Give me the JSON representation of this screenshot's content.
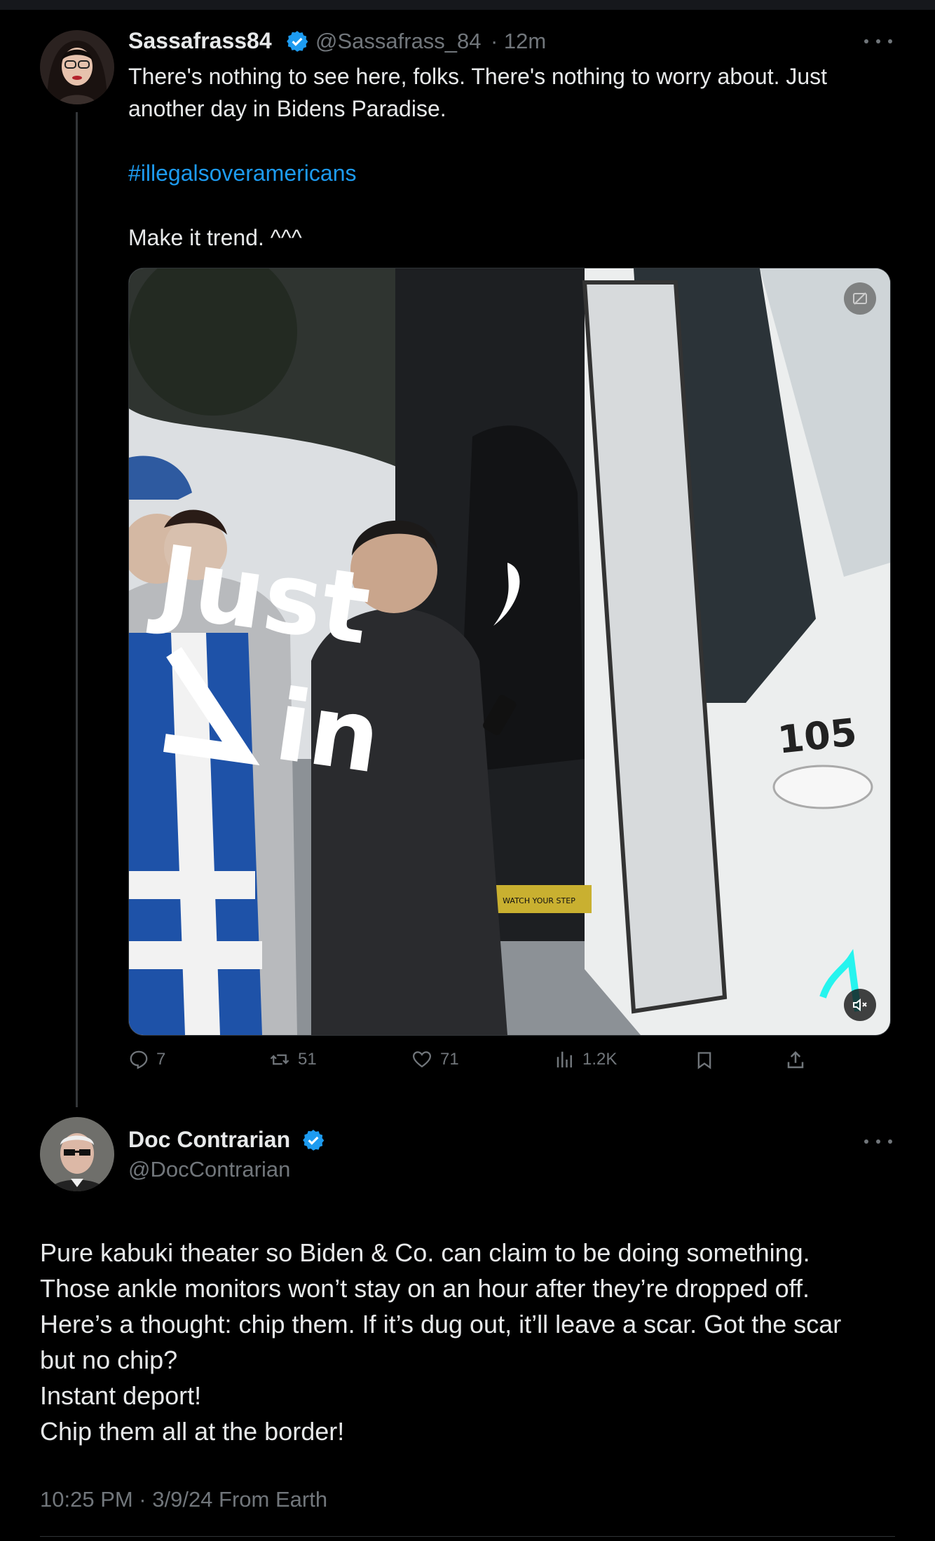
{
  "tweet1": {
    "display_name": "Sassafrass84",
    "handle": "@Sassafrass_84",
    "time": "· 12m",
    "line1": "There's nothing to see here, folks. There's nothing to worry about. Just",
    "line2": "another day in Bidens Paradise.",
    "hashtag": "#illegalsoveramericans",
    "line3": "Make it trend. ^^^",
    "video_overlay_text_1": "Just",
    "video_overlay_text_2": "in",
    "bus_number": "105",
    "step_sign": "WATCH YOUR STEP",
    "actions": {
      "replies": "7",
      "reposts": "51",
      "likes": "71",
      "views": "1.2K"
    }
  },
  "tweet2": {
    "display_name": "Doc Contrarian",
    "handle": "@DocContrarian",
    "body_lines": [
      "Pure kabuki theater so Biden & Co. can claim to be doing something.",
      "Those ankle monitors won’t stay on an hour after they’re dropped off.",
      "Here’s a thought: chip them. If it’s dug out, it’ll leave a scar. Got the scar",
      "but no chip?",
      "Instant deport!",
      "Chip them all at the border!"
    ],
    "timestamp": "10:25 PM · 3/9/24 From Earth"
  },
  "colors": {
    "background": "#000000",
    "text": "#e7e9ea",
    "muted": "#71767b",
    "accent": "#1d9bf0"
  }
}
